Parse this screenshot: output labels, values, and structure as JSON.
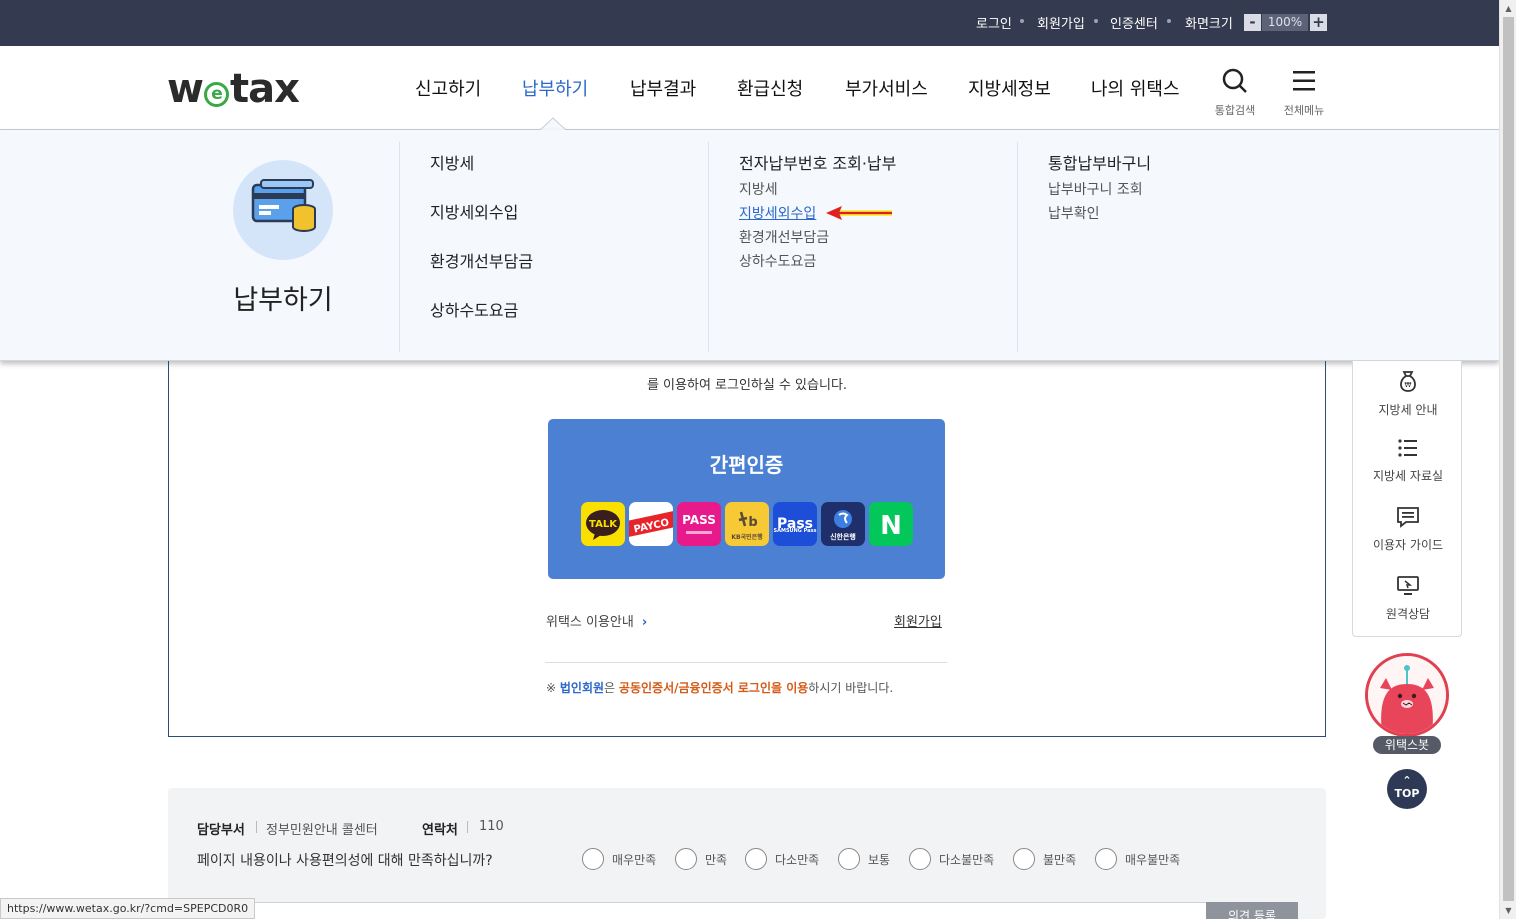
{
  "topbar": {
    "links": [
      "로그인",
      "회원가입",
      "인증센터",
      "화면크기"
    ],
    "zoom_minus": "-",
    "zoom_value": "100%",
    "zoom_plus": "+"
  },
  "header": {
    "logo_pre": "w",
    "logo_e": "e",
    "logo_post": "tax",
    "nav": [
      "신고하기",
      "납부하기",
      "납부결과",
      "환급신청",
      "부가서비스",
      "지방세정보",
      "나의 위택스"
    ],
    "active_nav": "납부하기",
    "search_label": "통합검색",
    "menu_label": "전체메뉴"
  },
  "mega_menu": {
    "title": "납부하기",
    "col1": [
      "지방세",
      "지방세외수입",
      "환경개선부담금",
      "상하수도요금"
    ],
    "col2": {
      "heading": "전자납부번호 조회·납부",
      "items": [
        "지방세",
        "지방세외수입",
        "환경개선부담금",
        "상하수도요금"
      ],
      "highlighted": "지방세외수입"
    },
    "col3": {
      "heading": "통합납부바구니",
      "items": [
        "납부바구니 조회",
        "납부확인"
      ]
    }
  },
  "main": {
    "login_text": "를 이용하여 로그인하실 수 있습니다.",
    "auth_title": "간편인증",
    "auth_icons": [
      "TALK",
      "PAYCO",
      "PASS",
      "KB국민은행",
      "SAMSUNG Pass",
      "신한은행",
      "N"
    ],
    "guide_link": "위택스 이용안내",
    "signup_link": "회원가입",
    "notice": {
      "prefix": "※ ",
      "corp": "법인회원",
      "mid": "은 ",
      "cert": "공동인증서/금융인증서 로그인을 이용",
      "suffix": "하시기 바랍니다."
    }
  },
  "survey": {
    "dept_label": "담당부서",
    "dept_value": "정부민원안내 콜센터",
    "contact_label": "연락처",
    "contact_value": "110",
    "question": "페이지 내용이나 사용편의성에 대해 만족하십니까?",
    "options": [
      "매우만족",
      "만족",
      "다소만족",
      "보통",
      "다소불만족",
      "불만족",
      "매우불만족"
    ],
    "submit_label": "의견 등록"
  },
  "quick_menu": {
    "items": [
      "지방세 안내",
      "지방세 자료실",
      "이용자 가이드",
      "원격상담"
    ],
    "bot_label": "위택스봇",
    "top_label": "TOP"
  },
  "status_url": "https://www.wetax.go.kr/?cmd=SPEPCD0R0",
  "colors": {
    "topbar": "#343a50",
    "accent": "#2c68c9",
    "auth_box": "#4b80d3",
    "logo_green": "#39a845",
    "orange": "#d35a17"
  }
}
